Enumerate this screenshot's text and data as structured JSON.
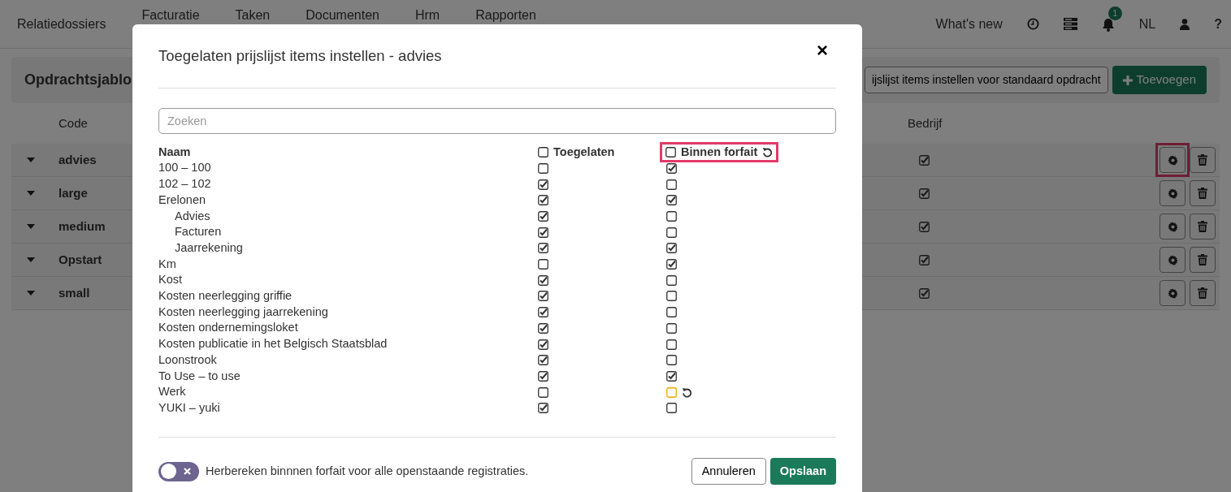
{
  "navbar": {
    "items": [
      {
        "label": "Relatiedossiers"
      },
      {
        "label": "Facturatie"
      },
      {
        "label": "Taken"
      },
      {
        "label": "Documenten"
      },
      {
        "label": "Hrm"
      },
      {
        "label": "Rapporten"
      }
    ],
    "whats_new": "What's new",
    "notification_count": "1",
    "language": "NL",
    "help": "?"
  },
  "page": {
    "title": "Opdrachtsjablo",
    "standard_button": "ijslijst items instellen voor standaard opdracht",
    "add_button": "Toevoegen",
    "columns": [
      "Code",
      "Bedrijf"
    ],
    "rows": [
      {
        "code": "advies",
        "bedrijf": true,
        "highlighted": true
      },
      {
        "code": "large",
        "bedrijf": true,
        "highlighted": false
      },
      {
        "code": "medium",
        "bedrijf": true,
        "highlighted": false
      },
      {
        "code": "Opstart",
        "bedrijf": true,
        "highlighted": false
      },
      {
        "code": "small",
        "bedrijf": true,
        "highlighted": false
      }
    ]
  },
  "modal": {
    "title": "Toegelaten prijslijst items instellen - advies",
    "close": "×",
    "search": {
      "placeholder": "Zoeken"
    },
    "columns": {
      "name": "Naam",
      "allowed": {
        "label": "Toegelaten",
        "checked": false
      },
      "included": {
        "label": "Binnen forfait",
        "checked": false,
        "highlighted": true
      }
    },
    "items": [
      {
        "name": "100 – 100",
        "allowed": false,
        "included": true,
        "changed": false
      },
      {
        "name": "102 – 102",
        "allowed": true,
        "included": false,
        "changed": false
      },
      {
        "name": "Erelonen",
        "allowed": true,
        "included": true,
        "changed": false,
        "children": [
          {
            "name": "Advies",
            "allowed": true,
            "included": false,
            "changed": false
          },
          {
            "name": "Facturen",
            "allowed": true,
            "included": false,
            "changed": false
          },
          {
            "name": "Jaarrekening",
            "allowed": true,
            "included": true,
            "changed": false
          }
        ]
      },
      {
        "name": "Km",
        "allowed": false,
        "included": true,
        "changed": false
      },
      {
        "name": "Kost",
        "allowed": true,
        "included": false,
        "changed": false
      },
      {
        "name": "Kosten neerlegging griffie",
        "allowed": true,
        "included": false,
        "changed": false
      },
      {
        "name": "Kosten neerlegging jaarrekening",
        "allowed": true,
        "included": false,
        "changed": false
      },
      {
        "name": "Kosten ondernemingsloket",
        "allowed": true,
        "included": false,
        "changed": false
      },
      {
        "name": "Kosten publicatie in het Belgisch Staatsblad",
        "allowed": true,
        "included": false,
        "changed": false
      },
      {
        "name": "Loonstrook",
        "allowed": true,
        "included": false,
        "changed": false
      },
      {
        "name": "To Use – to use",
        "allowed": true,
        "included": true,
        "changed": false
      },
      {
        "name": "Werk",
        "allowed": false,
        "included": false,
        "changed": true
      },
      {
        "name": "YUKI – yuki",
        "allowed": true,
        "included": false,
        "changed": false
      }
    ],
    "toggle": {
      "label": "Herbereken binnnen forfait voor alle openstaande registraties.",
      "on": false
    },
    "buttons": {
      "cancel": "Annuleren",
      "save": "Opslaan"
    }
  }
}
